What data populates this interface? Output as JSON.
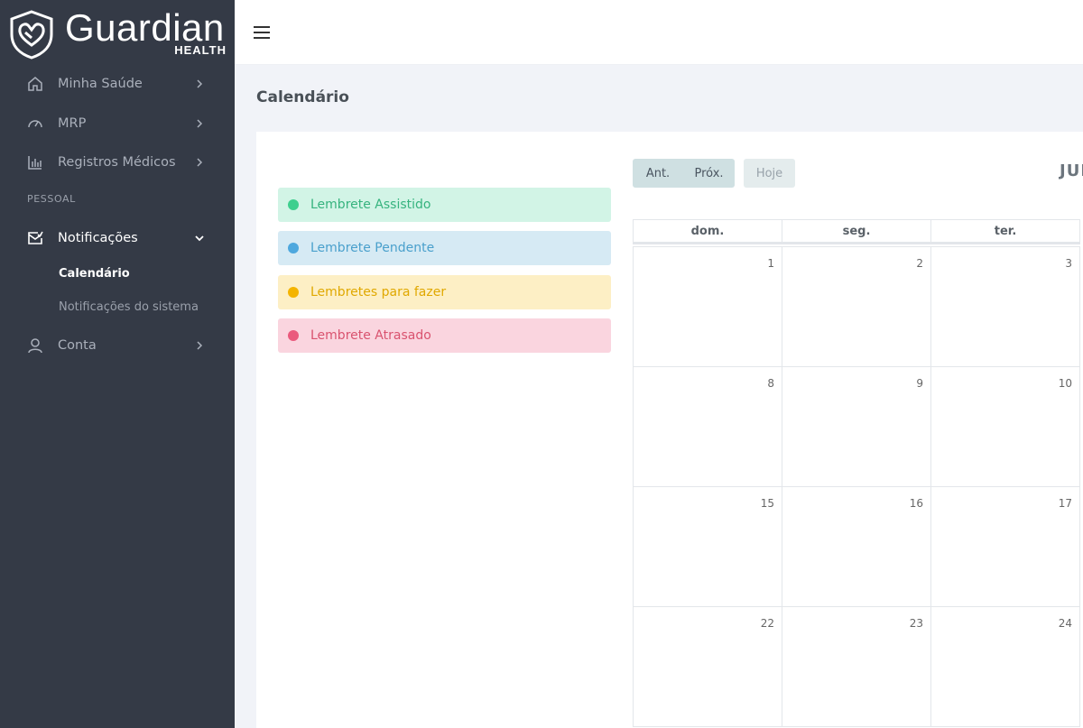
{
  "brand": {
    "name": "Guardian",
    "sub": "HEALTH"
  },
  "sidebar": {
    "items": [
      {
        "label": "Minha Saúde",
        "icon": "home-icon"
      },
      {
        "label": "MRP",
        "icon": "gauge-icon"
      },
      {
        "label": "Registros Médicos",
        "icon": "bar-chart-icon"
      }
    ],
    "section": "PESSOAL",
    "notifications": {
      "label": "Notificações",
      "icon": "mail-check-icon"
    },
    "sub_items": [
      {
        "label": "Calendário"
      },
      {
        "label": "Notificações do sistema"
      }
    ],
    "account": {
      "label": "Conta",
      "icon": "user-icon"
    }
  },
  "page": {
    "title": "Calendário"
  },
  "legend": [
    {
      "label": "Lembrete Assistido",
      "color": "#3ecf8e",
      "bg": "#d2f4e6",
      "fg": "#36b37e"
    },
    {
      "label": "Lembrete Pendente",
      "color": "#4ea8de",
      "bg": "#d6eaf4",
      "fg": "#4aa0cc"
    },
    {
      "label": "Lembretes para fazer",
      "color": "#f4b400",
      "bg": "#fdefc5",
      "fg": "#e0a800"
    },
    {
      "label": "Lembrete Atrasado",
      "color": "#ea5a7d",
      "bg": "#fad5df",
      "fg": "#d9536f"
    }
  ],
  "toolbar": {
    "prev": "Ant.",
    "next": "Próx.",
    "today": "Hoje",
    "month": "JULHO"
  },
  "calendar": {
    "weekdays": [
      "dom.",
      "seg.",
      "ter."
    ],
    "weeks": [
      [
        "1",
        "2",
        "3"
      ],
      [
        "8",
        "9",
        "10"
      ],
      [
        "15",
        "16",
        "17"
      ],
      [
        "22",
        "23",
        "24"
      ]
    ]
  }
}
